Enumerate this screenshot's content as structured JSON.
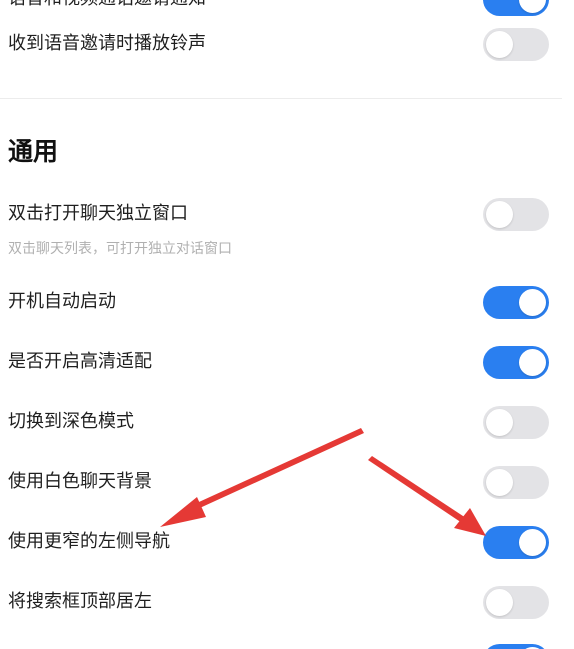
{
  "notifications": {
    "items": [
      {
        "label": "语音和视频通话邀请通知",
        "enabled": true
      },
      {
        "label": "收到语音邀请时播放铃声",
        "enabled": false
      }
    ]
  },
  "general": {
    "title": "通用",
    "items": [
      {
        "label": "双击打开聊天独立窗口",
        "description": "双击聊天列表，可打开独立对话窗口",
        "enabled": false
      },
      {
        "label": "开机自动启动",
        "enabled": true
      },
      {
        "label": "是否开启高清适配",
        "enabled": true
      },
      {
        "label": "切换到深色模式",
        "enabled": false
      },
      {
        "label": "使用白色聊天背景",
        "enabled": false
      },
      {
        "label": "使用更窄的左侧导航",
        "enabled": true
      },
      {
        "label": "将搜索框顶部居左",
        "enabled": false
      },
      {
        "enabled": true
      }
    ]
  },
  "colors": {
    "toggle_on": "#2a7ff0",
    "toggle_off": "#e3e3e6",
    "annotation_arrow": "#e53935"
  }
}
